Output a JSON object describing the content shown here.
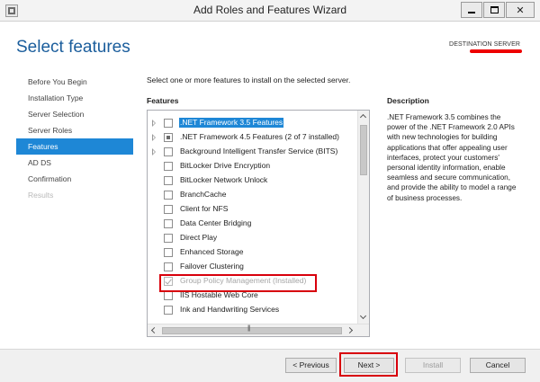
{
  "window": {
    "title": "Add Roles and Features Wizard",
    "icon": "server-manager-icon"
  },
  "header": {
    "page_title": "Select features",
    "destination_label": "DESTINATION SERVER",
    "destination_value_redacted": true
  },
  "nav": {
    "items": [
      {
        "label": "Before You Begin",
        "state": "normal"
      },
      {
        "label": "Installation Type",
        "state": "normal"
      },
      {
        "label": "Server Selection",
        "state": "normal"
      },
      {
        "label": "Server Roles",
        "state": "normal"
      },
      {
        "label": "Features",
        "state": "active"
      },
      {
        "label": "AD DS",
        "state": "normal"
      },
      {
        "label": "Confirmation",
        "state": "normal"
      },
      {
        "label": "Results",
        "state": "disabled"
      }
    ]
  },
  "main": {
    "instruction": "Select one or more features to install on the selected server.",
    "features_label": "Features",
    "features": [
      {
        "name": ".NET Framework 3.5 Features",
        "expandable": true,
        "check": "unchecked",
        "selected": true
      },
      {
        "name": ".NET Framework 4.5 Features (2 of 7 installed)",
        "expandable": true,
        "check": "partial"
      },
      {
        "name": "Background Intelligent Transfer Service (BITS)",
        "expandable": true,
        "check": "unchecked"
      },
      {
        "name": "BitLocker Drive Encryption",
        "expandable": false,
        "check": "unchecked"
      },
      {
        "name": "BitLocker Network Unlock",
        "expandable": false,
        "check": "unchecked"
      },
      {
        "name": "BranchCache",
        "expandable": false,
        "check": "unchecked"
      },
      {
        "name": "Client for NFS",
        "expandable": false,
        "check": "unchecked"
      },
      {
        "name": "Data Center Bridging",
        "expandable": false,
        "check": "unchecked"
      },
      {
        "name": "Direct Play",
        "expandable": false,
        "check": "unchecked"
      },
      {
        "name": "Enhanced Storage",
        "expandable": false,
        "check": "unchecked"
      },
      {
        "name": "Failover Clustering",
        "expandable": false,
        "check": "unchecked"
      },
      {
        "name": "Group Policy Management (Installed)",
        "expandable": false,
        "check": "installed",
        "highlighted": true
      },
      {
        "name": "IIS Hostable Web Core",
        "expandable": false,
        "check": "unchecked"
      },
      {
        "name": "Ink and Handwriting Services",
        "expandable": false,
        "check": "unchecked"
      }
    ]
  },
  "description": {
    "label": "Description",
    "text": ".NET Framework 3.5 combines the power of the .NET Framework 2.0 APIs with new technologies for building applications that offer appealing user interfaces, protect your customers' personal identity information, enable seamless and secure communication, and provide the ability to model a range of business processes."
  },
  "footer": {
    "previous_label": "< Previous",
    "next_label": "Next >",
    "install_label": "Install",
    "cancel_label": "Cancel"
  },
  "colors": {
    "accent": "#1e87d6",
    "title_blue": "#1a5d9c",
    "annotation_red": "#d8000c"
  }
}
